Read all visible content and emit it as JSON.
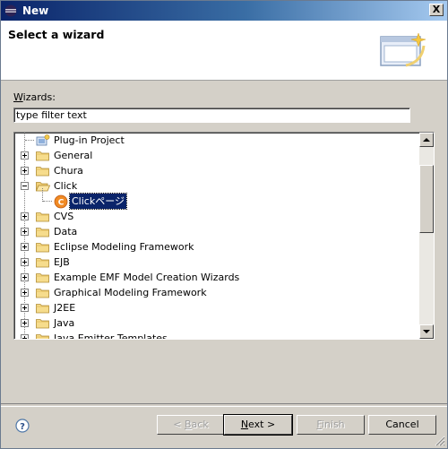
{
  "window": {
    "title": "New",
    "close_label": "X"
  },
  "banner": {
    "title": "Select a wizard"
  },
  "wizards": {
    "label": "Wizards:",
    "label_mnemonic": "W",
    "label_rest": "izards:"
  },
  "filter": {
    "value": "type filter text"
  },
  "tree": {
    "items": [
      {
        "label": "Plug-in Project",
        "kind": "project",
        "expander": "none"
      },
      {
        "label": "General",
        "kind": "folder",
        "expander": "plus"
      },
      {
        "label": "Chura",
        "kind": "folder",
        "expander": "plus"
      },
      {
        "label": "Click",
        "kind": "folder-open",
        "expander": "minus"
      },
      {
        "label": "Clickページ",
        "kind": "click-page",
        "expander": "none",
        "selected": true
      },
      {
        "label": "CVS",
        "kind": "folder",
        "expander": "plus"
      },
      {
        "label": "Data",
        "kind": "folder",
        "expander": "plus"
      },
      {
        "label": "Eclipse Modeling Framework",
        "kind": "folder",
        "expander": "plus"
      },
      {
        "label": "EJB",
        "kind": "folder",
        "expander": "plus"
      },
      {
        "label": "Example EMF Model Creation Wizards",
        "kind": "folder",
        "expander": "plus"
      },
      {
        "label": "Graphical Modeling Framework",
        "kind": "folder",
        "expander": "plus"
      },
      {
        "label": "J2EE",
        "kind": "folder",
        "expander": "plus"
      },
      {
        "label": "Java",
        "kind": "folder",
        "expander": "plus"
      },
      {
        "label": "Java Emitter Templates",
        "kind": "folder",
        "expander": "plus"
      }
    ]
  },
  "buttons": {
    "back": {
      "prefix": "< ",
      "mnemonic": "B",
      "rest": "ack"
    },
    "next": {
      "mnemonic": "N",
      "rest": "ext >"
    },
    "finish": {
      "mnemonic": "F",
      "rest": "inish"
    },
    "cancel": {
      "label": "Cancel"
    }
  },
  "colors": {
    "selection": "#0a246a",
    "dialog_bg": "#d4d0c8",
    "titlebar_start": "#0a246a"
  }
}
